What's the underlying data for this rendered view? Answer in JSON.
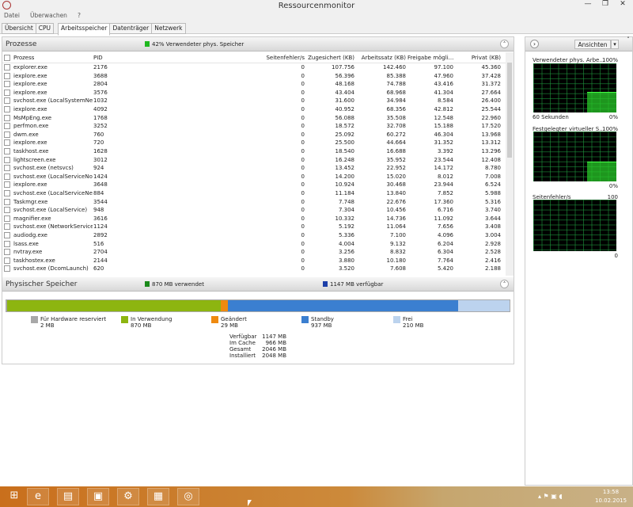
{
  "window": {
    "title": "Ressourcenmonitor",
    "min": "—",
    "max": "❐",
    "close": "✕"
  },
  "menu": [
    "Datei",
    "Überwachen",
    "?"
  ],
  "tabs": [
    "Übersicht",
    "CPU",
    "Arbeitsspeicher",
    "Datenträger",
    "Netzwerk"
  ],
  "processes": {
    "title": "Prozesse",
    "status": "42% Verwendeter phys. Speicher",
    "status_color": "#1fb81f",
    "columns": [
      "Prozess",
      "PID",
      "Seitenfehler/s",
      "Zugesichert (KB)",
      "Arbeitssatz (KB)",
      "Freigabe mögli...",
      "Privat (KB)"
    ],
    "rows": [
      [
        "explorer.exe",
        "2176",
        "0",
        "107.756",
        "142.460",
        "97.100",
        "45.360"
      ],
      [
        "iexplore.exe",
        "3688",
        "0",
        "56.396",
        "85.388",
        "47.960",
        "37.428"
      ],
      [
        "iexplore.exe",
        "2804",
        "0",
        "48.168",
        "74.788",
        "43.416",
        "31.372"
      ],
      [
        "iexplore.exe",
        "3576",
        "0",
        "43.404",
        "68.968",
        "41.304",
        "27.664"
      ],
      [
        "svchost.exe (LocalSystemNet...",
        "1032",
        "0",
        "31.600",
        "34.984",
        "8.584",
        "26.400"
      ],
      [
        "iexplore.exe",
        "4092",
        "0",
        "40.952",
        "68.356",
        "42.812",
        "25.544"
      ],
      [
        "MsMpEng.exe",
        "1768",
        "0",
        "56.088",
        "35.508",
        "12.548",
        "22.960"
      ],
      [
        "perfmon.exe",
        "3252",
        "0",
        "18.572",
        "32.708",
        "15.188",
        "17.520"
      ],
      [
        "dwm.exe",
        "760",
        "0",
        "25.092",
        "60.272",
        "46.304",
        "13.968"
      ],
      [
        "iexplore.exe",
        "720",
        "0",
        "25.500",
        "44.664",
        "31.352",
        "13.312"
      ],
      [
        "taskhost.exe",
        "1628",
        "0",
        "18.540",
        "16.688",
        "3.392",
        "13.296"
      ],
      [
        "lightscreen.exe",
        "3012",
        "0",
        "16.248",
        "35.952",
        "23.544",
        "12.408"
      ],
      [
        "svchost.exe (netsvcs)",
        "924",
        "0",
        "13.452",
        "22.952",
        "14.172",
        "8.780"
      ],
      [
        "svchost.exe (LocalServiceNo...",
        "1424",
        "0",
        "14.200",
        "15.020",
        "8.012",
        "7.008"
      ],
      [
        "iexplore.exe",
        "3648",
        "0",
        "10.924",
        "30.468",
        "23.944",
        "6.524"
      ],
      [
        "svchost.exe (LocalServiceNet...",
        "884",
        "0",
        "11.184",
        "13.840",
        "7.852",
        "5.988"
      ],
      [
        "Taskmgr.exe",
        "3544",
        "0",
        "7.748",
        "22.676",
        "17.360",
        "5.316"
      ],
      [
        "svchost.exe (LocalService)",
        "948",
        "0",
        "7.304",
        "10.456",
        "6.716",
        "3.740"
      ],
      [
        "magnifier.exe",
        "3616",
        "0",
        "10.332",
        "14.736",
        "11.092",
        "3.644"
      ],
      [
        "svchost.exe (NetworkService)",
        "1124",
        "0",
        "5.192",
        "11.064",
        "7.656",
        "3.408"
      ],
      [
        "audiodg.exe",
        "2892",
        "0",
        "5.336",
        "7.100",
        "4.096",
        "3.004"
      ],
      [
        "lsass.exe",
        "516",
        "0",
        "4.004",
        "9.132",
        "6.204",
        "2.928"
      ],
      [
        "nvtray.exe",
        "2704",
        "0",
        "3.256",
        "8.832",
        "6.304",
        "2.528"
      ],
      [
        "taskhostex.exe",
        "2144",
        "0",
        "3.880",
        "10.180",
        "7.764",
        "2.416"
      ],
      [
        "svchost.exe (DcomLaunch)",
        "620",
        "0",
        "3.520",
        "7.608",
        "5.420",
        "2.188"
      ]
    ]
  },
  "physical": {
    "title": "Physischer Speicher",
    "used": "870 MB verwendet",
    "used_color": "#1a8a1a",
    "available": "1147 MB verfügbar",
    "available_color": "#1c3fa8",
    "segments": [
      {
        "label": "Für Hardware reserviert",
        "value": "2 MB",
        "mb": 2,
        "color": "#a8a8a8"
      },
      {
        "label": "In Verwendung",
        "value": "870 MB",
        "mb": 870,
        "color": "#8db510"
      },
      {
        "label": "Geändert",
        "value": "29 MB",
        "mb": 29,
        "color": "#ef8a10"
      },
      {
        "label": "Standby",
        "value": "937 MB",
        "mb": 937,
        "color": "#3b7fd0"
      },
      {
        "label": "Frei",
        "value": "210 MB",
        "mb": 210,
        "color": "#bcd3ee"
      }
    ],
    "stats": [
      [
        "Verfügbar",
        "1147 MB"
      ],
      [
        "Im Cache",
        "966 MB"
      ],
      [
        "Gesamt",
        "2046 MB"
      ],
      [
        "Installiert",
        "2048 MB"
      ]
    ]
  },
  "right": {
    "expand": "›",
    "views": "Ansichten",
    "dropdown": "▾",
    "graphs": [
      {
        "title": "Verwendeter phys. Arbe...",
        "max": "100%",
        "min": "0%",
        "sub": "60 Sekunden",
        "level": 42
      },
      {
        "title": "Festgelegter virtueller S...",
        "max": "100%",
        "min": "0%",
        "sub": "",
        "level": 40
      },
      {
        "title": "Seitenfehler/s",
        "max": "100",
        "min": "0",
        "sub": "",
        "level": 0
      }
    ]
  },
  "taskbar": {
    "time": "13:58",
    "date": "10.02.2015",
    "apps": [
      "⊞",
      "e",
      "▤",
      "▣",
      "⚙",
      "▦",
      "◎"
    ]
  }
}
